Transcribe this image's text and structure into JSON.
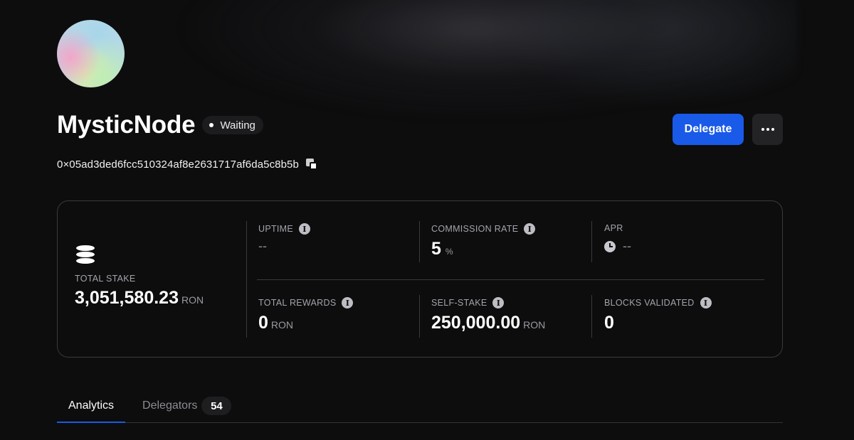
{
  "validator": {
    "name": "MysticNode",
    "status": "Waiting",
    "address": "0×05ad3ded6fcc510324af8e2631717af6da5c8b5b"
  },
  "actions": {
    "delegate_label": "Delegate",
    "more_icon": "more-horizontal-icon"
  },
  "stats": {
    "total_stake": {
      "label": "TOTAL STAKE",
      "value": "3,051,580.23",
      "unit": "RON"
    },
    "uptime": {
      "label": "UPTIME",
      "value": "--"
    },
    "commission_rate": {
      "label": "COMMISSION RATE",
      "value": "5",
      "unit": "%"
    },
    "apr": {
      "label": "APR",
      "value": "--"
    },
    "total_rewards": {
      "label": "TOTAL REWARDS",
      "value": "0",
      "unit": "RON"
    },
    "self_stake": {
      "label": "SELF-STAKE",
      "value": "250,000.00",
      "unit": "RON"
    },
    "blocks_validated": {
      "label": "BLOCKS VALIDATED",
      "value": "0"
    }
  },
  "tabs": [
    {
      "label": "Analytics",
      "active": true
    },
    {
      "label": "Delegators",
      "count": "54",
      "active": false
    }
  ],
  "colors": {
    "accent": "#1a5ae8",
    "background": "#0d0d0e",
    "card_border": "#3a3a3f"
  }
}
